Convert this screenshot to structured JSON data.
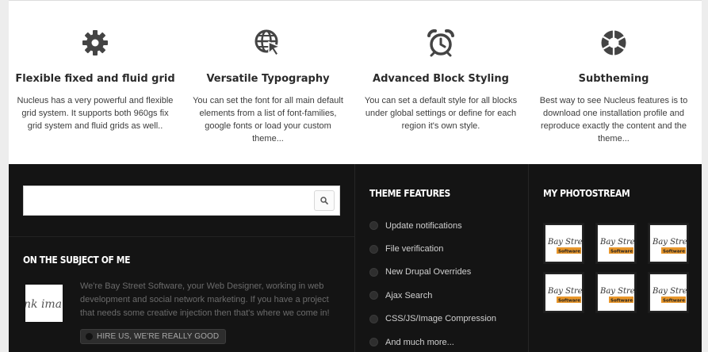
{
  "features": [
    {
      "icon": "gear-icon",
      "title": "Flexible fixed and fluid grid",
      "text": "Nucleus has a very powerful and flexible grid system. It supports both 960gs fix grid system and fluid grids as well.."
    },
    {
      "icon": "globe-cursor-icon",
      "title": "Versatile Typography",
      "text": "You can set the font for all main default elements from a list of font-families, google fonts or load your custom theme..."
    },
    {
      "icon": "alarm-clock-icon",
      "title": "Advanced Block Styling",
      "text": "You can set a default style for all blocks under global settings or define for each region it's own style."
    },
    {
      "icon": "aperture-icon",
      "title": "Subtheming",
      "text": "Best way to see Nucleus features is to download one installation profile and reproduce exactly the content and the theme..."
    }
  ],
  "search": {
    "value": "",
    "placeholder": ""
  },
  "about": {
    "title": "On the subject of me",
    "logo_text": "nk ima",
    "text": "We're Bay Street Software, your Web Designer, working in web development and social network marketing. If you have a project that needs some creative injection then that's where we come in!",
    "button_label": "HIRE US, WE'RE REALLY GOOD"
  },
  "theme_features": {
    "title": "Theme features",
    "items": [
      "Update notifications",
      "File verification",
      "New Drupal Overrides",
      "Ajax Search",
      "CSS/JS/Image Compression",
      "And much more..."
    ]
  },
  "photostream": {
    "title": "My photostream",
    "photos": [
      {
        "line1": "Bay Street",
        "line2": "Software"
      },
      {
        "line1": "Bay Street",
        "line2": "Software"
      },
      {
        "line1": "Bay Street",
        "line2": "Software"
      },
      {
        "line1": "Bay Street",
        "line2": "Software"
      },
      {
        "line1": "Bay Street",
        "line2": "Software"
      },
      {
        "line1": "Bay Street",
        "line2": "Software"
      }
    ]
  },
  "colors": {
    "footer_bg": "#141414",
    "accent_orange": "#e8962a",
    "features_bg": "#ffffff"
  }
}
